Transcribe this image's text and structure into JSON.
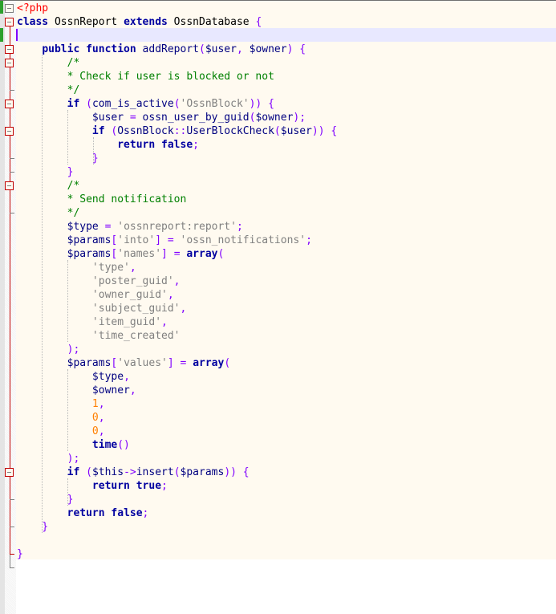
{
  "editor": {
    "language": "php",
    "colors": {
      "keyword": "#0000a0",
      "variable": "#000080",
      "operator": "#8000ff",
      "string": "#808080",
      "comment": "#008000",
      "number": "#ff8000",
      "php_tag": "#ff0000",
      "background": "#fffaf0",
      "current_line": "#e8e8ff"
    },
    "lines": [
      [
        {
          "t": "php",
          "v": "<?php"
        }
      ],
      [
        {
          "t": "kw",
          "v": "class"
        },
        {
          "t": "cls",
          "v": " OssnReport "
        },
        {
          "t": "kw",
          "v": "extends"
        },
        {
          "t": "cls",
          "v": " OssnDatabase "
        },
        {
          "t": "op",
          "v": "{"
        }
      ],
      [],
      [
        {
          "t": "cls",
          "v": "    "
        },
        {
          "t": "kw",
          "v": "public function"
        },
        {
          "t": "fn",
          "v": " addReport"
        },
        {
          "t": "op",
          "v": "("
        },
        {
          "t": "var",
          "v": "$user"
        },
        {
          "t": "op",
          "v": ", "
        },
        {
          "t": "var",
          "v": "$owner"
        },
        {
          "t": "op",
          "v": ") {"
        }
      ],
      [
        {
          "t": "cmt",
          "v": "        /*"
        }
      ],
      [
        {
          "t": "cmt",
          "v": "        * Check if user is blocked or not"
        }
      ],
      [
        {
          "t": "cmt",
          "v": "        */"
        }
      ],
      [
        {
          "t": "cls",
          "v": "        "
        },
        {
          "t": "kw",
          "v": "if"
        },
        {
          "t": "op",
          "v": " ("
        },
        {
          "t": "fn",
          "v": "com_is_active"
        },
        {
          "t": "op",
          "v": "("
        },
        {
          "t": "str",
          "v": "'OssnBlock'"
        },
        {
          "t": "op",
          "v": ")) {"
        }
      ],
      [
        {
          "t": "cls",
          "v": "            "
        },
        {
          "t": "var",
          "v": "$user"
        },
        {
          "t": "op",
          "v": " = "
        },
        {
          "t": "fn",
          "v": "ossn_user_by_guid"
        },
        {
          "t": "op",
          "v": "("
        },
        {
          "t": "var",
          "v": "$owner"
        },
        {
          "t": "op",
          "v": ");"
        }
      ],
      [
        {
          "t": "cls",
          "v": "            "
        },
        {
          "t": "kw",
          "v": "if"
        },
        {
          "t": "op",
          "v": " ("
        },
        {
          "t": "fn",
          "v": "OssnBlock"
        },
        {
          "t": "op",
          "v": "::"
        },
        {
          "t": "fn",
          "v": "UserBlockCheck"
        },
        {
          "t": "op",
          "v": "("
        },
        {
          "t": "var",
          "v": "$user"
        },
        {
          "t": "op",
          "v": ")) {"
        }
      ],
      [
        {
          "t": "cls",
          "v": "                "
        },
        {
          "t": "kw",
          "v": "return false"
        },
        {
          "t": "op",
          "v": ";"
        }
      ],
      [
        {
          "t": "op",
          "v": "            }"
        }
      ],
      [
        {
          "t": "op",
          "v": "        }"
        }
      ],
      [
        {
          "t": "cmt",
          "v": "        /*"
        }
      ],
      [
        {
          "t": "cmt",
          "v": "        * Send notification"
        }
      ],
      [
        {
          "t": "cmt",
          "v": "        */"
        }
      ],
      [
        {
          "t": "cls",
          "v": "        "
        },
        {
          "t": "var",
          "v": "$type"
        },
        {
          "t": "op",
          "v": " = "
        },
        {
          "t": "str",
          "v": "'ossnreport:report'"
        },
        {
          "t": "op",
          "v": ";"
        }
      ],
      [
        {
          "t": "cls",
          "v": "        "
        },
        {
          "t": "var",
          "v": "$params"
        },
        {
          "t": "op",
          "v": "["
        },
        {
          "t": "str",
          "v": "'into'"
        },
        {
          "t": "op",
          "v": "] = "
        },
        {
          "t": "str",
          "v": "'ossn_notifications'"
        },
        {
          "t": "op",
          "v": ";"
        }
      ],
      [
        {
          "t": "cls",
          "v": "        "
        },
        {
          "t": "var",
          "v": "$params"
        },
        {
          "t": "op",
          "v": "["
        },
        {
          "t": "str",
          "v": "'names'"
        },
        {
          "t": "op",
          "v": "] = "
        },
        {
          "t": "kw",
          "v": "array"
        },
        {
          "t": "op",
          "v": "("
        }
      ],
      [
        {
          "t": "cls",
          "v": "            "
        },
        {
          "t": "str",
          "v": "'type'"
        },
        {
          "t": "op",
          "v": ","
        }
      ],
      [
        {
          "t": "cls",
          "v": "            "
        },
        {
          "t": "str",
          "v": "'poster_guid'"
        },
        {
          "t": "op",
          "v": ","
        }
      ],
      [
        {
          "t": "cls",
          "v": "            "
        },
        {
          "t": "str",
          "v": "'owner_guid'"
        },
        {
          "t": "op",
          "v": ","
        }
      ],
      [
        {
          "t": "cls",
          "v": "            "
        },
        {
          "t": "str",
          "v": "'subject_guid'"
        },
        {
          "t": "op",
          "v": ","
        }
      ],
      [
        {
          "t": "cls",
          "v": "            "
        },
        {
          "t": "str",
          "v": "'item_guid'"
        },
        {
          "t": "op",
          "v": ","
        }
      ],
      [
        {
          "t": "cls",
          "v": "            "
        },
        {
          "t": "str",
          "v": "'time_created'"
        }
      ],
      [
        {
          "t": "op",
          "v": "        );"
        }
      ],
      [
        {
          "t": "cls",
          "v": "        "
        },
        {
          "t": "var",
          "v": "$params"
        },
        {
          "t": "op",
          "v": "["
        },
        {
          "t": "str",
          "v": "'values'"
        },
        {
          "t": "op",
          "v": "] = "
        },
        {
          "t": "kw",
          "v": "array"
        },
        {
          "t": "op",
          "v": "("
        }
      ],
      [
        {
          "t": "cls",
          "v": "            "
        },
        {
          "t": "var",
          "v": "$type"
        },
        {
          "t": "op",
          "v": ","
        }
      ],
      [
        {
          "t": "cls",
          "v": "            "
        },
        {
          "t": "var",
          "v": "$owner"
        },
        {
          "t": "op",
          "v": ","
        }
      ],
      [
        {
          "t": "cls",
          "v": "            "
        },
        {
          "t": "num",
          "v": "1"
        },
        {
          "t": "op",
          "v": ","
        }
      ],
      [
        {
          "t": "cls",
          "v": "            "
        },
        {
          "t": "num",
          "v": "0"
        },
        {
          "t": "op",
          "v": ","
        }
      ],
      [
        {
          "t": "cls",
          "v": "            "
        },
        {
          "t": "num",
          "v": "0"
        },
        {
          "t": "op",
          "v": ","
        }
      ],
      [
        {
          "t": "cls",
          "v": "            "
        },
        {
          "t": "kw",
          "v": "time"
        },
        {
          "t": "op",
          "v": "()"
        }
      ],
      [
        {
          "t": "op",
          "v": "        );"
        }
      ],
      [
        {
          "t": "cls",
          "v": "        "
        },
        {
          "t": "kw",
          "v": "if"
        },
        {
          "t": "op",
          "v": " ("
        },
        {
          "t": "var",
          "v": "$this"
        },
        {
          "t": "op",
          "v": "->"
        },
        {
          "t": "fn",
          "v": "insert"
        },
        {
          "t": "op",
          "v": "("
        },
        {
          "t": "var",
          "v": "$params"
        },
        {
          "t": "op",
          "v": ")) {"
        }
      ],
      [
        {
          "t": "cls",
          "v": "            "
        },
        {
          "t": "kw",
          "v": "return true"
        },
        {
          "t": "op",
          "v": ";"
        }
      ],
      [
        {
          "t": "op",
          "v": "        }"
        }
      ],
      [
        {
          "t": "cls",
          "v": "        "
        },
        {
          "t": "kw",
          "v": "return false"
        },
        {
          "t": "op",
          "v": ";"
        }
      ],
      [
        {
          "t": "op",
          "v": "    }"
        }
      ],
      [],
      [
        {
          "t": "op",
          "v": "}"
        }
      ]
    ]
  }
}
